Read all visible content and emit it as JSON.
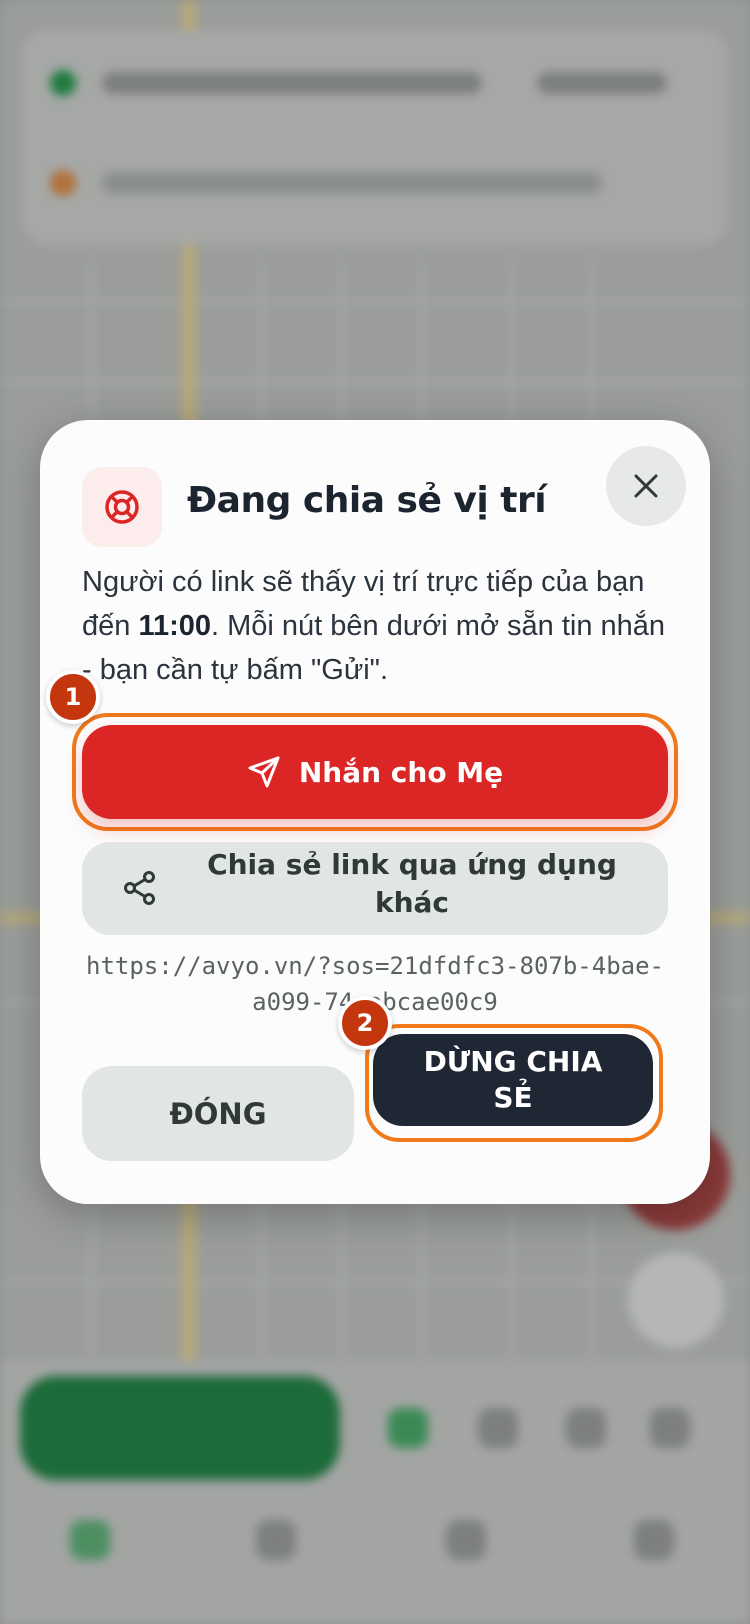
{
  "modal": {
    "title": "Đang chia sẻ vị trí",
    "desc_part1": "Người có link sẽ thấy vị trí trực tiếp của bạn đến ",
    "desc_time": "11:00",
    "desc_part2": ". Mỗi nút bên dưới mở sẵn tin nhắn - bạn cần tự bấm \"Gửi\".",
    "primary_button": "Nhắn cho Mẹ",
    "secondary_button": "Chia sẻ link qua ứng dụng khác",
    "share_link": "https://avyo.vn/?sos=21dfdfc3-807b-4bae-a099-74aabcae00c9",
    "close_button": "ĐÓNG",
    "stop_button": "DỪNG CHIA SẺ",
    "step_badges": [
      "1",
      "2"
    ]
  },
  "colors": {
    "primary_red": "#dc2626",
    "highlight_orange": "#f07a1a",
    "badge": "#c4360e",
    "dark_button": "#1e2733"
  },
  "icons": {
    "title_icon": "lifebuoy-icon",
    "close_icon": "close-icon",
    "send_icon": "send-icon",
    "share_icon": "share-icon"
  }
}
